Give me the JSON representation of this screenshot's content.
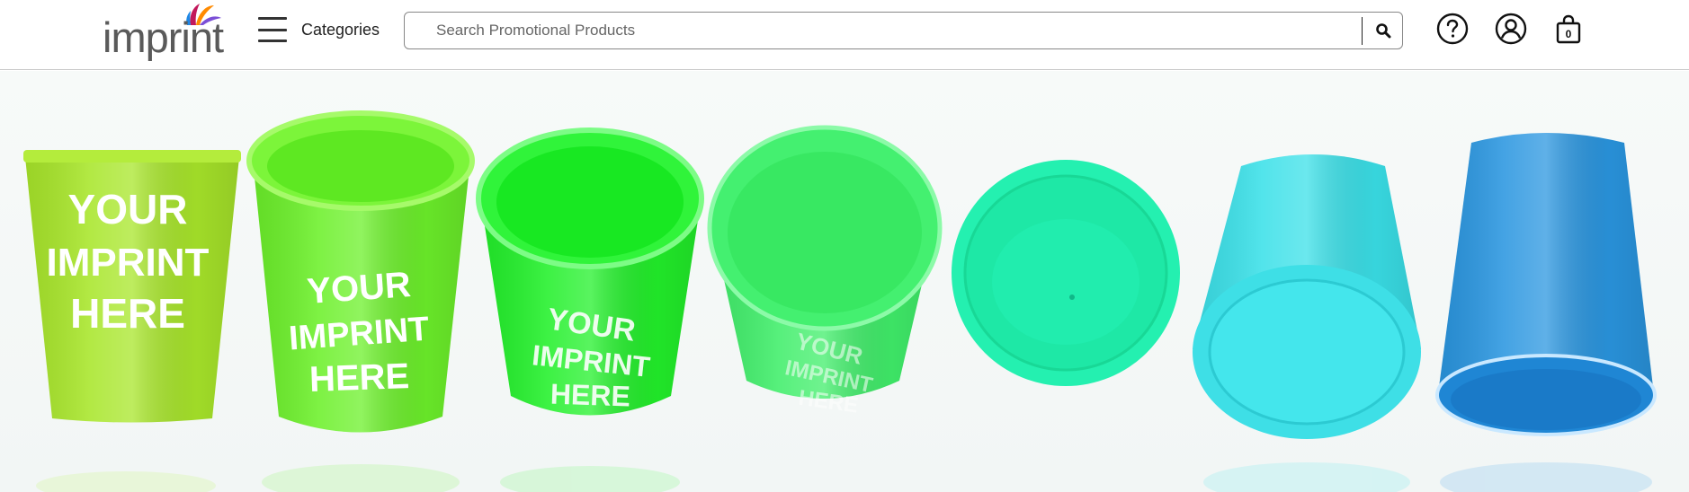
{
  "brand": {
    "name": "imprint"
  },
  "nav": {
    "categories_label": "Categories"
  },
  "search": {
    "placeholder": "Search Promotional Products",
    "value": ""
  },
  "actions": {
    "cart_count": "0"
  },
  "hero": {
    "imprint_text": [
      "YOUR",
      "IMPRINT",
      "HERE"
    ],
    "cup_colors": [
      "#a8e62a",
      "#6cf02a",
      "#22f02a",
      "#40ee6a",
      "#24f0b0",
      "#3ae0e8",
      "#2a96e0"
    ]
  },
  "icons": {
    "menu": "hamburger-icon",
    "search": "magnifier-icon",
    "help": "question-circle-icon",
    "account": "user-circle-icon",
    "cart": "shopping-bag-icon"
  }
}
